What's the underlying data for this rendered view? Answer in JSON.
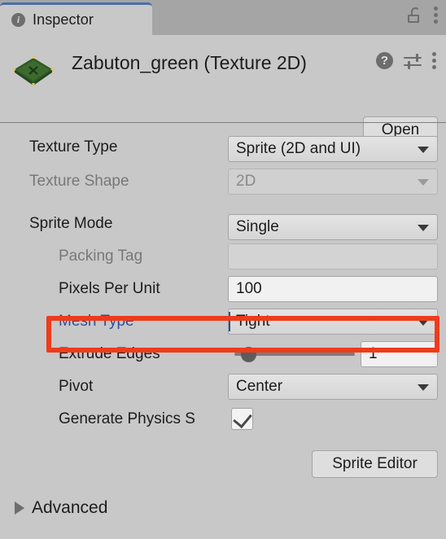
{
  "window": {
    "tab": {
      "label": "Inspector",
      "icon": "info-icon"
    },
    "tabbar_icons": {
      "lock": "unlocked-padlock-icon",
      "menu": "kebab-menu-icon"
    },
    "accent_tab_color": "#4a6fa5",
    "background_color": "#c8c8c8"
  },
  "object_header": {
    "title": "Zabuton_green (Texture 2D)",
    "thumbnail": "green-cushion-sprite-thumbnail",
    "icons": {
      "help": "?",
      "preset": "preset-sliders-icon",
      "menu": "kebab-menu-icon"
    },
    "open_button": "Open"
  },
  "properties": [
    {
      "label": "Texture Type",
      "value": "Sprite (2D and UI)",
      "control": "dropdown",
      "disabled": false,
      "indent": false
    },
    {
      "label": "Texture Shape",
      "value": "2D",
      "control": "dropdown",
      "disabled": true,
      "indent": false
    },
    {
      "label": "Sprite Mode",
      "value": "Single",
      "control": "dropdown",
      "disabled": false,
      "indent": false
    },
    {
      "label": "Packing Tag",
      "value": "",
      "control": "textfield",
      "disabled": true,
      "indent": true
    },
    {
      "label": "Pixels Per Unit",
      "value": "100",
      "control": "textfield",
      "disabled": false,
      "indent": true
    },
    {
      "label": "Mesh Type",
      "value": "Tight",
      "control": "dropdown",
      "disabled": false,
      "indent": true,
      "highlighted": true
    },
    {
      "label": "Extrude Edges",
      "value": "1",
      "control": "slider",
      "disabled": false,
      "indent": true,
      "slider_percent": 5
    },
    {
      "label": "Pivot",
      "value": "Center",
      "control": "dropdown",
      "disabled": false,
      "indent": true
    },
    {
      "label": "Generate Physics S",
      "value": "checked",
      "control": "checkbox",
      "disabled": false,
      "indent": true
    }
  ],
  "buttons": {
    "sprite_editor": "Sprite Editor"
  },
  "foldout": {
    "advanced": "Advanced",
    "expanded": false
  },
  "highlight": {
    "color": "#ee3b1c",
    "target": "Mesh Type"
  }
}
